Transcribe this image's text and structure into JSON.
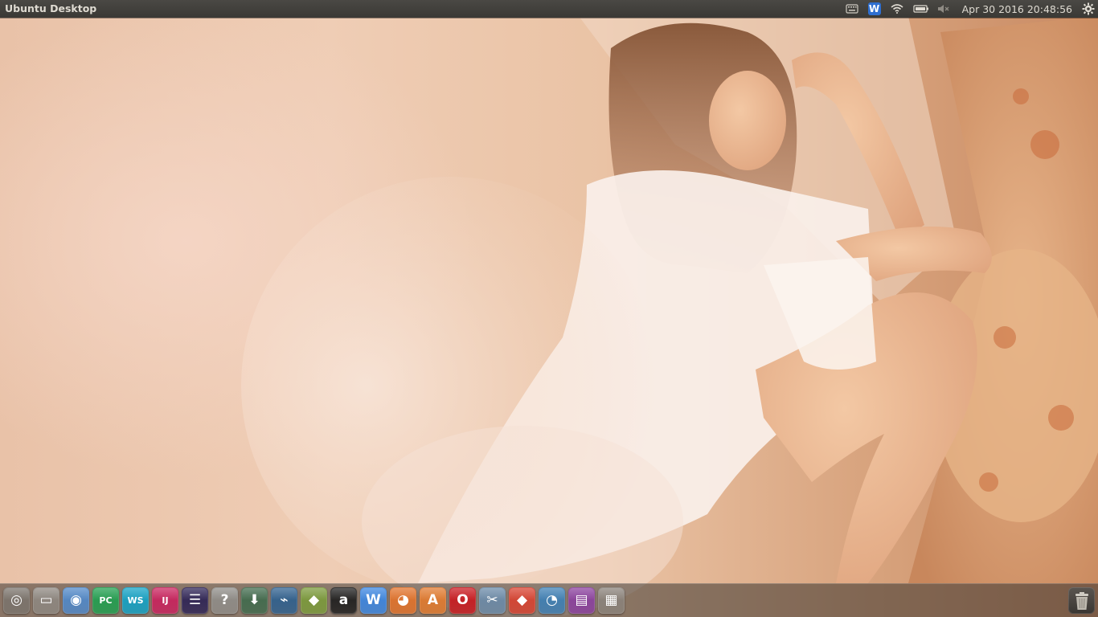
{
  "panel": {
    "title": "Ubuntu Desktop",
    "clock": "Apr 30 2016 20:48:56"
  },
  "indicators": [
    {
      "icon": "keyboard-icon"
    },
    {
      "icon": "wps-office-icon",
      "label": "W",
      "color": "#2f6fd0"
    },
    {
      "icon": "wifi-icon"
    },
    {
      "icon": "battery-icon"
    },
    {
      "icon": "volume-muted-icon"
    },
    {
      "icon": "gear-icon"
    }
  ],
  "launcher": {
    "items": [
      {
        "name": "ubuntu-dash",
        "icon": "ubuntu-logo-icon",
        "glyph": "◎",
        "bg": "#7a736c"
      },
      {
        "name": "files",
        "icon": "file-manager-icon",
        "glyph": "▭",
        "bg": "#8d8780"
      },
      {
        "name": "chromium",
        "icon": "chromium-icon",
        "glyph": "◉",
        "bg": "#4f88c9"
      },
      {
        "name": "pycharm",
        "icon": "pycharm-icon",
        "glyph": "PC",
        "bg": "#1f9f4f"
      },
      {
        "name": "webstorm",
        "icon": "webstorm-icon",
        "glyph": "WS",
        "bg": "#11a2c6"
      },
      {
        "name": "intellij",
        "icon": "intellij-icon",
        "glyph": "IJ",
        "bg": "#c9215d"
      },
      {
        "name": "eclipse",
        "icon": "eclipse-icon",
        "glyph": "☰",
        "bg": "#2c2255"
      },
      {
        "name": "help",
        "icon": "help-icon",
        "glyph": "?",
        "bg": "#8e8c88"
      },
      {
        "name": "downloader",
        "icon": "download-icon",
        "glyph": "⬇",
        "bg": "#3f6a4c"
      },
      {
        "name": "mysql-workbench",
        "icon": "mysql-workbench-icon",
        "glyph": "⌁",
        "bg": "#2d5f8e"
      },
      {
        "name": "app-green",
        "icon": "layers-icon",
        "glyph": "◆",
        "bg": "#7a9a3a"
      },
      {
        "name": "app-a",
        "icon": "a-circle-icon",
        "glyph": "a",
        "bg": "#1d1d1d"
      },
      {
        "name": "wps-writer",
        "icon": "wps-writer-icon",
        "glyph": "W",
        "bg": "#3a86e2"
      },
      {
        "name": "firefox",
        "icon": "firefox-icon",
        "glyph": "◕",
        "bg": "#e2722a"
      },
      {
        "name": "software-center",
        "icon": "software-center-icon",
        "glyph": "A",
        "bg": "#e27a2e"
      },
      {
        "name": "opera",
        "icon": "opera-icon",
        "glyph": "O",
        "bg": "#c9181e"
      },
      {
        "name": "app-tools",
        "icon": "tools-icon",
        "glyph": "✂",
        "bg": "#6a8aa8"
      },
      {
        "name": "git",
        "icon": "git-icon",
        "glyph": "◆",
        "bg": "#d8412f"
      },
      {
        "name": "app-swirl",
        "icon": "swirl-icon",
        "glyph": "◔",
        "bg": "#3c7fb5"
      },
      {
        "name": "app-purple",
        "icon": "window-icon",
        "glyph": "▤",
        "bg": "#8a3f9e"
      },
      {
        "name": "workspaces",
        "icon": "workspace-switcher-icon",
        "glyph": "▦",
        "bg": "#8a827a"
      }
    ],
    "trash": {
      "icon": "trash-icon"
    }
  }
}
